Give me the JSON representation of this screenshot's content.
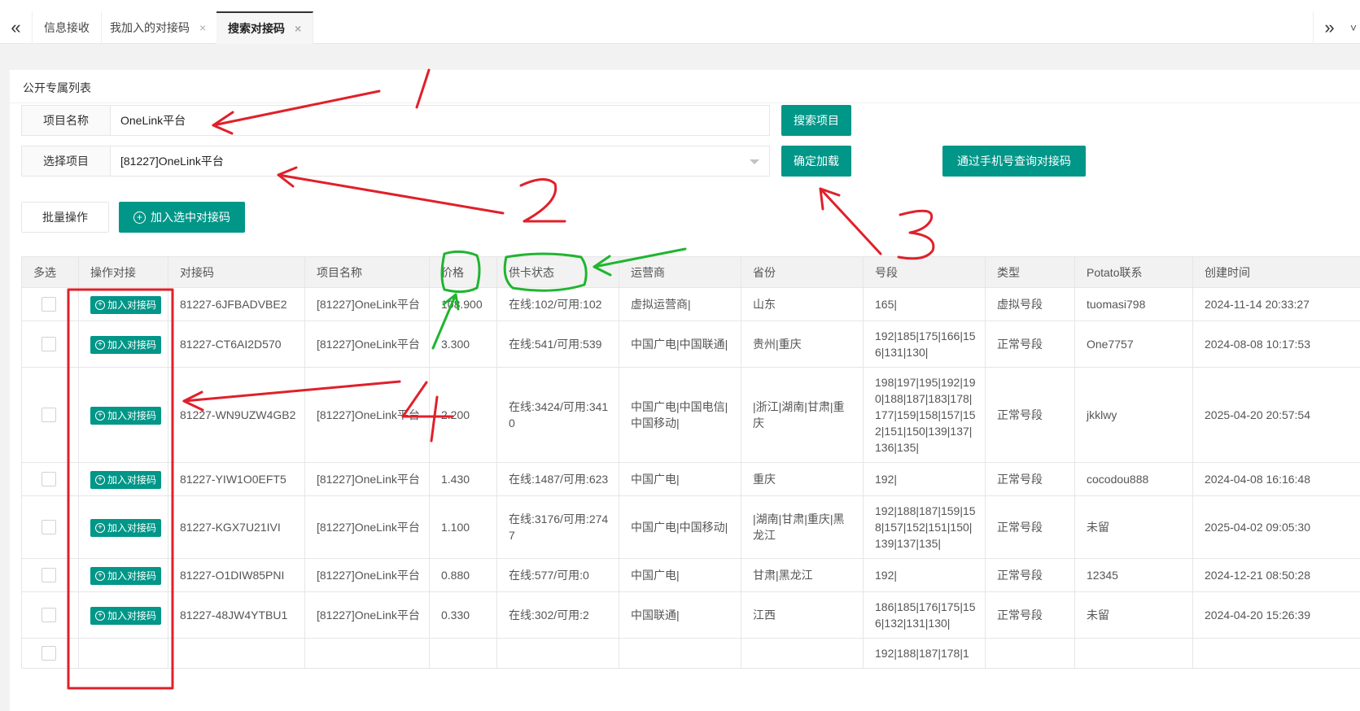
{
  "tabs": [
    {
      "label": "信息接收",
      "closable": false,
      "active": false
    },
    {
      "label": "我加入的对接码",
      "closable": true,
      "active": false
    },
    {
      "label": "搜索对接码",
      "closable": true,
      "active": true
    }
  ],
  "tab_close_glyph": "×",
  "tab_nav": {
    "prev_icon": "«",
    "next_icon": "»",
    "menu_icon": "˅"
  },
  "panel": {
    "title": "公开专属列表"
  },
  "form": {
    "project_name_label": "项目名称",
    "project_name_value": "OneLink平台",
    "search_button": "搜索项目",
    "select_label": "选择项目",
    "select_value": "[81227]OneLink平台",
    "confirm_button": "确定加载",
    "phone_query_button": "通过手机号查询对接码"
  },
  "batch": {
    "label": "批量操作",
    "add_selected_button": "加入选中对接码",
    "plus_glyph": "+"
  },
  "table": {
    "columns": [
      "多选",
      "操作对接",
      "对接码",
      "项目名称",
      "价格",
      "供卡状态",
      "运营商",
      "省份",
      "号段",
      "类型",
      "Potato联系",
      "创建时间"
    ],
    "join_button_label": "加入对接码",
    "rows": [
      {
        "code": "81227-6JFBADVBE2",
        "project": "[81227]OneLink平台",
        "price": "108.900",
        "status": "在线:102/可用:102",
        "carrier": "虚拟运营商|",
        "province": "山东",
        "segments": "165|",
        "type": "虚拟号段",
        "potato": "tuomasi798",
        "created": "2024-11-14 20:33:27"
      },
      {
        "code": "81227-CT6AI2D570",
        "project": "[81227]OneLink平台",
        "price": "3.300",
        "status": "在线:541/可用:539",
        "carrier": "中国广电|中国联通|",
        "province": "贵州|重庆",
        "segments": "192|185|175|166|156|131|130|",
        "type": "正常号段",
        "potato": "One7757",
        "created": "2024-08-08 10:17:53"
      },
      {
        "code": "81227-WN9UZW4GB2",
        "project": "[81227]OneLink平台",
        "price": "2.200",
        "status": "在线:3424/可用:3410",
        "carrier": "中国广电|中国电信|中国移动|",
        "province": "|浙江|湖南|甘肃|重庆",
        "segments": "198|197|195|192|190|188|187|183|178|177|159|158|157|152|151|150|139|137|136|135|",
        "type": "正常号段",
        "potato": "jkklwy",
        "created": "2025-04-20 20:57:54"
      },
      {
        "code": "81227-YIW1O0EFT5",
        "project": "[81227]OneLink平台",
        "price": "1.430",
        "status": "在线:1487/可用:623",
        "carrier": "中国广电|",
        "province": "重庆",
        "segments": "192|",
        "type": "正常号段",
        "potato": "cocodou888",
        "created": "2024-04-08 16:16:48"
      },
      {
        "code": "81227-KGX7U21IVI",
        "project": "[81227]OneLink平台",
        "price": "1.100",
        "status": "在线:3176/可用:2747",
        "carrier": "中国广电|中国移动|",
        "province": "|湖南|甘肃|重庆|黑龙江",
        "segments": "192|188|187|159|158|157|152|151|150|139|137|135|",
        "type": "正常号段",
        "potato": "未留",
        "created": "2025-04-02 09:05:30"
      },
      {
        "code": "81227-O1DIW85PNI",
        "project": "[81227]OneLink平台",
        "price": "0.880",
        "status": "在线:577/可用:0",
        "carrier": "中国广电|",
        "province": "甘肃|黑龙江",
        "segments": "192|",
        "type": "正常号段",
        "potato": "12345",
        "created": "2024-12-21 08:50:28"
      },
      {
        "code": "81227-48JW4YTBU1",
        "project": "[81227]OneLink平台",
        "price": "0.330",
        "status": "在线:302/可用:2",
        "carrier": "中国联通|",
        "province": "江西",
        "segments": "186|185|176|175|156|132|131|130|",
        "type": "正常号段",
        "potato": "未留",
        "created": "2024-04-20 15:26:39"
      },
      {
        "code": "",
        "project": "",
        "price": "",
        "status": "",
        "carrier": "",
        "province": "",
        "segments": "192|188|187|178|1",
        "type": "",
        "potato": "",
        "created": ""
      }
    ]
  },
  "annotations": {
    "colors": {
      "red": "#e0202a",
      "green": "#1fb52f"
    },
    "numbers": [
      "1",
      "2",
      "3",
      "4"
    ]
  }
}
